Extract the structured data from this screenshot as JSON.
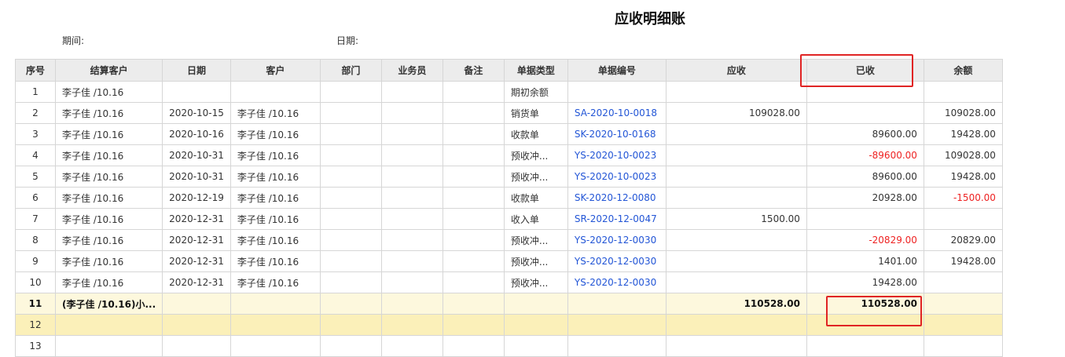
{
  "report": {
    "title": "应收明细账",
    "period_label": "期间:",
    "date_label": "日期:"
  },
  "table": {
    "columns": [
      "序号",
      "结算客户",
      "日期",
      "客户",
      "部门",
      "业务员",
      "备注",
      "单据类型",
      "单据编号",
      "应收",
      "已收",
      "余额"
    ],
    "rows": [
      {
        "no": "1",
        "settle": "李子佳 /10.16",
        "date": "",
        "customer": "",
        "dept": "",
        "sales": "",
        "note": "",
        "type": "期初余额",
        "doc": "",
        "recv": "",
        "received": "",
        "balance": ""
      },
      {
        "no": "2",
        "settle": "李子佳 /10.16",
        "date": "2020-10-15",
        "customer": "李子佳 /10.16",
        "dept": "",
        "sales": "",
        "note": "",
        "type": "销货单",
        "doc": "SA-2020-10-0018",
        "recv": "109028.00",
        "received": "",
        "balance": "109028.00"
      },
      {
        "no": "3",
        "settle": "李子佳 /10.16",
        "date": "2020-10-16",
        "customer": "李子佳 /10.16",
        "dept": "",
        "sales": "",
        "note": "",
        "type": "收款单",
        "doc": "SK-2020-10-0168",
        "recv": "",
        "received": "89600.00",
        "balance": "19428.00"
      },
      {
        "no": "4",
        "settle": "李子佳 /10.16",
        "date": "2020-10-31",
        "customer": "李子佳 /10.16",
        "dept": "",
        "sales": "",
        "note": "",
        "type": "预收冲...",
        "doc": "YS-2020-10-0023",
        "recv": "",
        "received": "-89600.00",
        "balance": "109028.00"
      },
      {
        "no": "5",
        "settle": "李子佳 /10.16",
        "date": "2020-10-31",
        "customer": "李子佳 /10.16",
        "dept": "",
        "sales": "",
        "note": "",
        "type": "预收冲...",
        "doc": "YS-2020-10-0023",
        "recv": "",
        "received": "89600.00",
        "balance": "19428.00"
      },
      {
        "no": "6",
        "settle": "李子佳 /10.16",
        "date": "2020-12-19",
        "customer": "李子佳 /10.16",
        "dept": "",
        "sales": "",
        "note": "",
        "type": "收款单",
        "doc": "SK-2020-12-0080",
        "recv": "",
        "received": "20928.00",
        "balance": "-1500.00"
      },
      {
        "no": "7",
        "settle": "李子佳 /10.16",
        "date": "2020-12-31",
        "customer": "李子佳 /10.16",
        "dept": "",
        "sales": "",
        "note": "",
        "type": "收入单",
        "doc": "SR-2020-12-0047",
        "recv": "1500.00",
        "received": "",
        "balance": ""
      },
      {
        "no": "8",
        "settle": "李子佳 /10.16",
        "date": "2020-12-31",
        "customer": "李子佳 /10.16",
        "dept": "",
        "sales": "",
        "note": "",
        "type": "预收冲...",
        "doc": "YS-2020-12-0030",
        "recv": "",
        "received": "-20829.00",
        "balance": "20829.00"
      },
      {
        "no": "9",
        "settle": "李子佳 /10.16",
        "date": "2020-12-31",
        "customer": "李子佳 /10.16",
        "dept": "",
        "sales": "",
        "note": "",
        "type": "预收冲...",
        "doc": "YS-2020-12-0030",
        "recv": "",
        "received": "1401.00",
        "balance": "19428.00"
      },
      {
        "no": "10",
        "settle": "李子佳 /10.16",
        "date": "2020-12-31",
        "customer": "李子佳 /10.16",
        "dept": "",
        "sales": "",
        "note": "",
        "type": "预收冲...",
        "doc": "YS-2020-12-0030",
        "recv": "",
        "received": "19428.00",
        "balance": ""
      }
    ],
    "subtotal": {
      "no": "11",
      "settle": "(李子佳 /10.16)小...",
      "recv": "110528.00",
      "received": "110528.00"
    },
    "extra_rows": [
      "12",
      "13"
    ]
  },
  "colors": {
    "header_bg": "#ececec",
    "link": "#2255d6",
    "negative": "#ee2222",
    "subtotal_bg": "#fdf8dd",
    "highlight_row_bg": "#fbf0b9",
    "annotation_box": "#e02424"
  }
}
